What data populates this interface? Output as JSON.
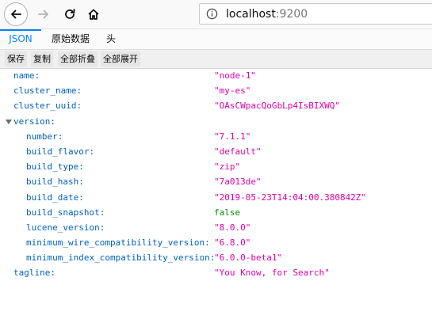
{
  "browser": {
    "url_host": "localhost",
    "url_port": ":9200"
  },
  "tabs": [
    {
      "label": "JSON",
      "active": true
    },
    {
      "label": "原始数据",
      "active": false
    },
    {
      "label": "头",
      "active": false
    }
  ],
  "toolbar": {
    "save": "保存",
    "copy": "复制",
    "collapse_all": "全部折叠",
    "expand_all": "全部展开"
  },
  "json": {
    "name": {
      "key": "name:",
      "value": "\"node-1\""
    },
    "cluster_name": {
      "key": "cluster_name:",
      "value": "\"my-es\""
    },
    "cluster_uuid": {
      "key": "cluster_uuid:",
      "value": "\"OAsCWpacQoGbLp4IsBIXWQ\""
    },
    "version": {
      "key": "version:",
      "expanded": true,
      "number": {
        "key": "number:",
        "value": "\"7.1.1\""
      },
      "build_flavor": {
        "key": "build_flavor:",
        "value": "\"default\""
      },
      "build_type": {
        "key": "build_type:",
        "value": "\"zip\""
      },
      "build_hash": {
        "key": "build_hash:",
        "value": "\"7a013de\""
      },
      "build_date": {
        "key": "build_date:",
        "value": "\"2019-05-23T14:04:00.380842Z\""
      },
      "build_snapshot": {
        "key": "build_snapshot:",
        "value": "false"
      },
      "lucene_version": {
        "key": "lucene_version:",
        "value": "\"8.0.0\""
      },
      "minimum_wire_compatibility_version": {
        "key": "minimum_wire_compatibility_version:",
        "value": "\"6.8.0\""
      },
      "minimum_index_compatibility_version": {
        "key": "minimum_index_compatibility_version:",
        "value": "\"6.0.0-beta1\""
      }
    },
    "tagline": {
      "key": "tagline:",
      "value": "\"You Know, for Search\""
    }
  },
  "colors": {
    "key": "#0060b9",
    "string": "#dd00a9",
    "boolean": "#058b00",
    "active_tab": "#0a84ff"
  }
}
